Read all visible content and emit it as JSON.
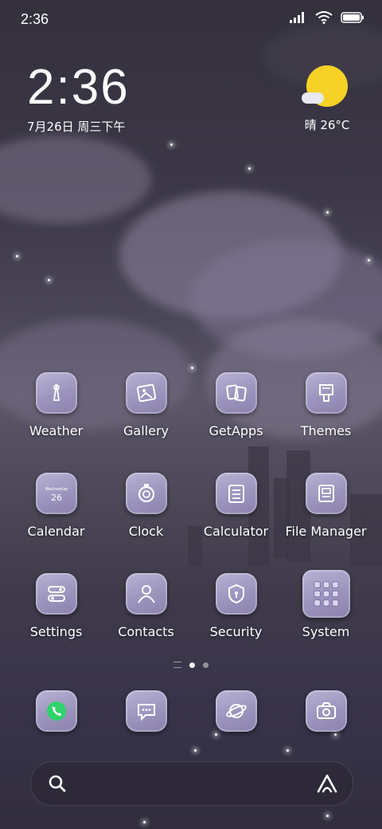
{
  "status_bar": {
    "time": "2:36"
  },
  "clock_widget": {
    "time": "2:36",
    "date": "7月26日 周三下午"
  },
  "weather_widget": {
    "condition_temp": "晴 26°C",
    "icon": "sunny-cloud-icon",
    "sun_color": "#f6d226"
  },
  "apps": [
    {
      "label": "Weather",
      "icon": "weather-icon"
    },
    {
      "label": "Gallery",
      "icon": "gallery-icon"
    },
    {
      "label": "GetApps",
      "icon": "getapps-icon"
    },
    {
      "label": "Themes",
      "icon": "themes-icon"
    },
    {
      "label": "Calendar",
      "icon": "calendar-icon",
      "icon_text": "Wednesday 26"
    },
    {
      "label": "Clock",
      "icon": "clock-icon"
    },
    {
      "label": "Calculator",
      "icon": "calculator-icon"
    },
    {
      "label": "File Manager",
      "icon": "file-manager-icon"
    },
    {
      "label": "Settings",
      "icon": "settings-icon"
    },
    {
      "label": "Contacts",
      "icon": "contacts-icon"
    },
    {
      "label": "Security",
      "icon": "security-icon"
    },
    {
      "label": "System",
      "icon": "folder-icon"
    }
  ],
  "dock": [
    {
      "icon": "phone-icon"
    },
    {
      "icon": "messages-icon"
    },
    {
      "icon": "browser-icon"
    },
    {
      "icon": "camera-icon"
    }
  ],
  "pages": {
    "count": 2,
    "active": 1
  },
  "search_bar": {
    "left_icon": "search-icon",
    "right_icon": "assistant-icon"
  },
  "colors": {
    "icon_bg": "#a59dc5",
    "phone_green": "#2fd36a"
  }
}
